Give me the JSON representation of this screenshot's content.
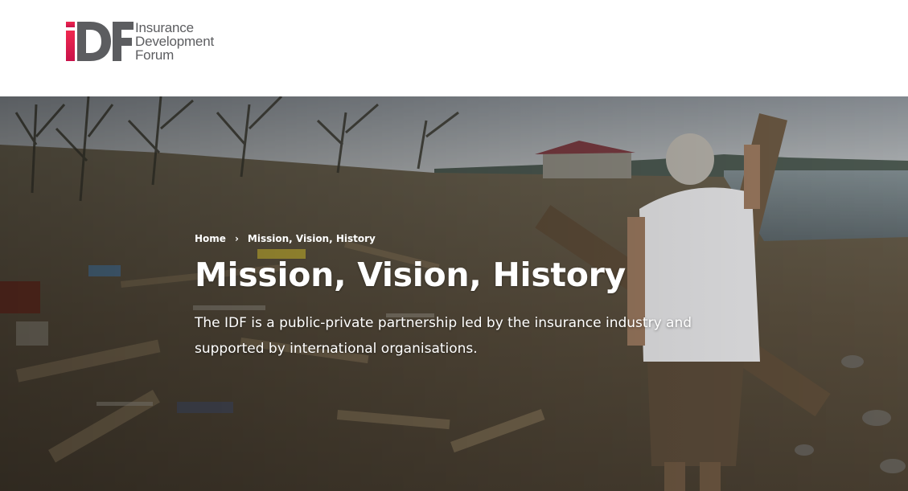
{
  "header": {
    "logo": {
      "mark_letters": "IDF",
      "lines": [
        "Insurance",
        "Development",
        "Forum"
      ]
    }
  },
  "hero": {
    "breadcrumb": {
      "home": "Home",
      "separator": "›",
      "current": "Mission, Vision, History"
    },
    "title": "Mission, Vision, History",
    "lead": "The IDF is a public-private partnership led by the insurance industry and supported by international organisations."
  },
  "colors": {
    "brand_magenta": "#e6194f",
    "brand_grey": "#5c5d60",
    "hero_text": "#ffffff"
  }
}
